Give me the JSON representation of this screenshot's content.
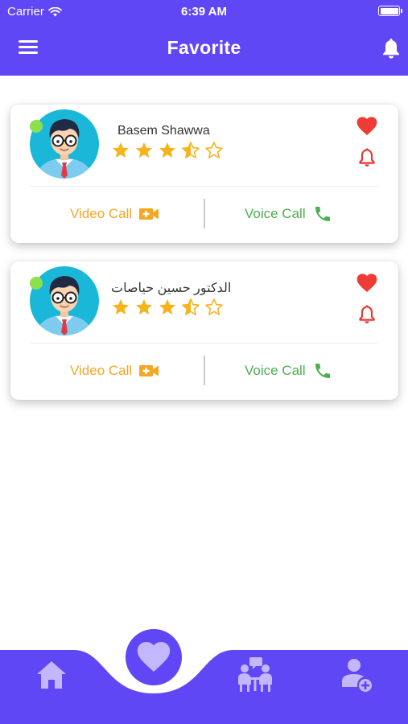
{
  "status_bar": {
    "carrier": "Carrier",
    "time": "6:39 AM"
  },
  "header": {
    "title": "Favorite",
    "menu_icon": "hamburger-menu-icon",
    "notification_icon": "bell-icon"
  },
  "doctors": [
    {
      "name": "Basem Shawwa",
      "rating": 3.5,
      "max_rating": 5,
      "online": true,
      "favorite": true,
      "video_call_label": "Video Call",
      "voice_call_label": "Voice Call"
    },
    {
      "name": "الدكتور حسين حياصات",
      "rating": 3.5,
      "max_rating": 5,
      "online": true,
      "favorite": true,
      "video_call_label": "Video Call",
      "voice_call_label": "Voice Call"
    }
  ],
  "bottom_nav": {
    "items": [
      "home-icon",
      "favorite-heart-icon",
      "consultation-icon",
      "add-user-icon"
    ],
    "active": "favorite-heart-icon"
  },
  "colors": {
    "primary": "#6047f5",
    "bottom_nav_icon": "#c3b7ff",
    "video_call": "#f5a623",
    "voice_call": "#4caf50",
    "star": "#f5b31c",
    "heart": "#ee3b36",
    "card_bell": "#e53935",
    "online_dot": "#8be04e"
  }
}
